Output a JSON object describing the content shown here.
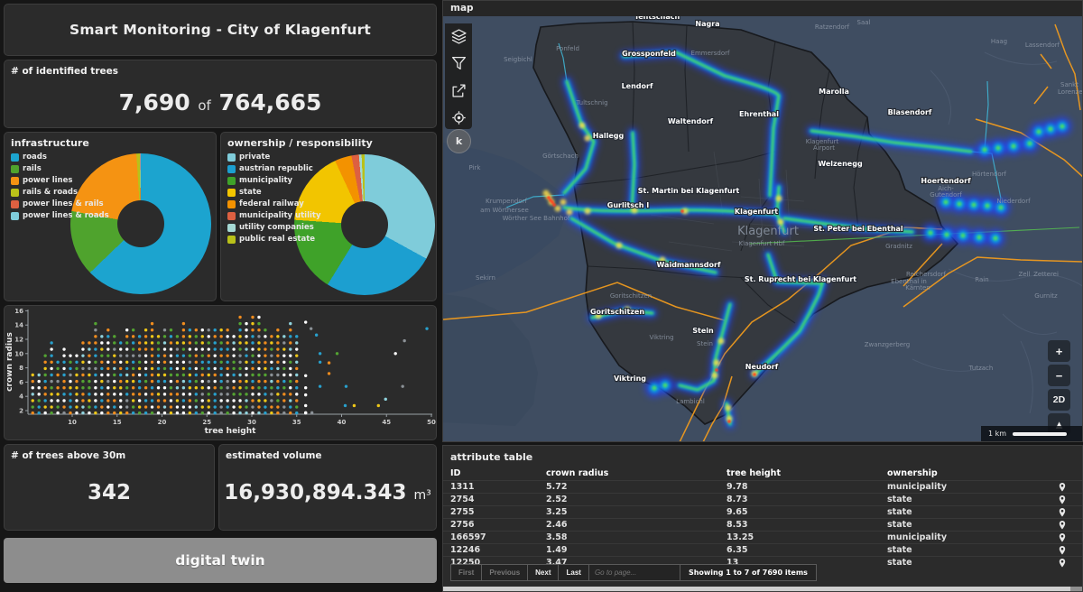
{
  "title": "Smart Monitoring - City of Klagenfurt",
  "identified_trees": {
    "label": "# of identified trees",
    "value": "7,690",
    "of_word": "of",
    "total": "764,665"
  },
  "chart_data": [
    {
      "type": "pie",
      "donut": true,
      "title": "infrastructure",
      "labels": [
        "roads",
        "rails",
        "power lines",
        "rails & roads",
        "power lines & rails",
        "power lines & roads"
      ],
      "values": [
        62.8,
        15.1,
        21.1,
        0.8,
        0.1,
        0.1
      ],
      "colors": [
        "#1ca4cf",
        "#4fa32d",
        "#f59312",
        "#b9c119",
        "#dd6041",
        "#7fccda"
      ],
      "legend_position": "left"
    },
    {
      "type": "pie",
      "donut": true,
      "title": "ownership / responsibility",
      "labels": [
        "private",
        "austrian republic",
        "municipality",
        "state",
        "federal railway",
        "municipality utility",
        "utility companies",
        "public real estate"
      ],
      "values": [
        33.0,
        25.8,
        17.3,
        17.0,
        3.9,
        1.7,
        0.6,
        0.7
      ],
      "colors": [
        "#7fccda",
        "#1c9fd0",
        "#3fa229",
        "#f2c500",
        "#f39200",
        "#dd6041",
        "#a5d9d4",
        "#b9c119"
      ],
      "legend_position": "left"
    },
    {
      "type": "scatter",
      "title": "",
      "xlabel": "tree height",
      "ylabel": "crown radius",
      "xlim": [
        5,
        50
      ],
      "ylim": [
        0,
        16
      ],
      "xticks": [
        10,
        15,
        20,
        25,
        30,
        35,
        40,
        45,
        50
      ],
      "yticks": [
        2,
        4,
        6,
        8,
        10,
        12,
        14,
        16
      ],
      "columns": {
        "x_start": 5.6,
        "x_step": 0.7,
        "y_start": 1.6,
        "y_step": 0.9,
        "y_max": [
          7.2,
          7.2,
          10,
          11.8,
          9,
          10.8,
          10,
          10,
          11.8,
          11.8,
          14.4,
          12.6,
          13.5,
          12.6,
          11.8,
          13.5,
          13.5,
          12.6,
          13.5,
          14.4,
          12.6,
          13.5,
          13.5,
          12.6,
          14.4,
          13.5,
          13.5,
          13.5,
          13.5,
          13.5,
          13.5,
          13.5,
          12.6,
          15.3,
          14.4,
          15.3,
          15.3,
          13.5,
          12.6,
          13.5,
          12.6,
          14.4,
          12.6
        ]
      },
      "outliers": [
        [
          36,
          14.4,
          1
        ],
        [
          36,
          6.9,
          1
        ],
        [
          36,
          5.2,
          1
        ],
        [
          36,
          4.2,
          1
        ],
        [
          36,
          2.7,
          1
        ],
        [
          36,
          1.7,
          1
        ],
        [
          36,
          0.9,
          1
        ],
        [
          36.6,
          13.5,
          5
        ],
        [
          36.7,
          1.7,
          5
        ],
        [
          37.2,
          12.6,
          2
        ],
        [
          37.6,
          10,
          2
        ],
        [
          37.6,
          8.8,
          2
        ],
        [
          37.6,
          5.4,
          2
        ],
        [
          38.6,
          8.7,
          0
        ],
        [
          38.6,
          7.2,
          0
        ],
        [
          39.5,
          10,
          3
        ],
        [
          40.4,
          2.7,
          2
        ],
        [
          40.5,
          5.4,
          2
        ],
        [
          41.4,
          2.7,
          4
        ],
        [
          44.1,
          2.7,
          4
        ],
        [
          44.9,
          3.6,
          6
        ],
        [
          46,
          10,
          1
        ],
        [
          46.8,
          5.4,
          5
        ],
        [
          47,
          11.8,
          5
        ],
        [
          49.5,
          13.5,
          2
        ]
      ],
      "point_colors": [
        "#f08c1e",
        "#ffffff",
        "#28a0cc",
        "#53a332",
        "#eec718",
        "#8b9196",
        "#8fd2dc"
      ]
    }
  ],
  "stats": {
    "above30": {
      "label": "# of trees above 30m",
      "value": "342"
    },
    "volume": {
      "label": "estimated volume",
      "value": "16,930,894.343",
      "unit": "m³"
    }
  },
  "digital_twin_label": "digital twin",
  "map": {
    "title": "map",
    "toolbar": [
      "layers",
      "filters",
      "share",
      "locate"
    ],
    "logo": "k",
    "controls": [
      "+",
      "−",
      "2D",
      "▲"
    ],
    "scale_label": "1 km",
    "labels_bold": [
      [
        "Tentschach",
        237,
        3
      ],
      [
        "Nagra",
        293,
        11
      ],
      [
        "Grossponfeld",
        228,
        44
      ],
      [
        "Lendorf",
        215,
        80
      ],
      [
        "Marolla",
        433,
        86
      ],
      [
        "Ehrenthal",
        350,
        111
      ],
      [
        "Blasendorf",
        517,
        109
      ],
      [
        "Waltendorf",
        274,
        119
      ],
      [
        "Hallegg",
        183,
        135
      ],
      [
        "Welzenegg",
        440,
        166
      ],
      [
        "Hoertendorf",
        557,
        185
      ],
      [
        "St. Martin bei Klagenfurt",
        272,
        196
      ],
      [
        "Gurlitsch I",
        205,
        212
      ],
      [
        "Klagenfurt",
        347,
        219
      ],
      [
        "St. Peter bei Ebenthal",
        460,
        238
      ],
      [
        "Waidmannsdorf",
        272,
        278
      ],
      [
        "St. Ruprecht bei Klagenfurt",
        396,
        294
      ],
      [
        "Goritschitzen",
        193,
        330
      ],
      [
        "Stein",
        288,
        351
      ],
      [
        "Neudorf",
        353,
        391
      ],
      [
        "Viktring",
        207,
        404
      ]
    ],
    "labels_faint": [
      [
        "Seigbichl",
        83,
        50
      ],
      [
        "Ponfeld",
        138,
        38
      ],
      [
        "Emmersdorf",
        296,
        43
      ],
      [
        "Ratzendorf",
        431,
        14
      ],
      [
        "Saal",
        466,
        9
      ],
      [
        "Haag",
        616,
        30
      ],
      [
        "Lassendorf",
        664,
        34
      ],
      [
        "Tultschnig",
        165,
        98
      ],
      [
        "Görtschach",
        130,
        157
      ],
      [
        "Pirk",
        35,
        170
      ],
      [
        "Krumpendorf",
        70,
        207
      ],
      [
        "am Wörthersee",
        68,
        217
      ],
      [
        "Wörther See Bahnhof",
        103,
        226
      ],
      [
        "Sekirn",
        47,
        292
      ],
      [
        "Goritschitzen",
        208,
        312
      ],
      [
        "Klagenfurt",
        360,
        242,
        13
      ],
      [
        "Klagenfurt Hbf",
        353,
        254
      ],
      [
        "Gradnitz",
        505,
        257
      ],
      [
        "Niederdorf",
        632,
        207
      ],
      [
        "Hörtendorf",
        605,
        177
      ],
      [
        "Aich-",
        557,
        193
      ],
      [
        "Gutendorf",
        557,
        200
      ],
      [
        "Reichersdorf",
        535,
        288
      ],
      [
        "Ebenthal in",
        516,
        296
      ],
      [
        "Kärnten",
        526,
        303
      ],
      [
        "Rain",
        597,
        294
      ],
      [
        "Zell",
        644,
        288
      ],
      [
        "Zetterei",
        668,
        288
      ],
      [
        "Gurnitz",
        668,
        312
      ],
      [
        "Zwanzgerberg",
        492,
        366
      ],
      [
        "Tutzach",
        596,
        392
      ],
      [
        "Lambichl",
        274,
        429
      ],
      [
        "Viktring",
        242,
        358
      ],
      [
        "Stein",
        290,
        365
      ],
      [
        "Klagenfurt",
        420,
        141
      ],
      [
        "Airport",
        422,
        148
      ],
      [
        "Sankt",
        694,
        78
      ],
      [
        "Lorenzen",
        697,
        86
      ]
    ]
  },
  "attribute_table": {
    "title": "attribute table",
    "columns": [
      "ID",
      "crown radius",
      "tree height",
      "ownership"
    ],
    "rows": [
      [
        "1311",
        "5.72",
        "9.78",
        "municipality"
      ],
      [
        "2754",
        "2.52",
        "8.73",
        "state"
      ],
      [
        "2755",
        "3.25",
        "9.65",
        "state"
      ],
      [
        "2756",
        "2.46",
        "8.53",
        "state"
      ],
      [
        "166597",
        "3.58",
        "13.25",
        "municipality"
      ],
      [
        "12246",
        "1.49",
        "6.35",
        "state"
      ],
      [
        "12250",
        "3.47",
        "13",
        "state"
      ]
    ],
    "pagination": {
      "first": "First",
      "previous": "Previous",
      "next": "Next",
      "last": "Last",
      "goto_placeholder": "Go to page...",
      "status": "Showing 1 to 7 of 7690 items"
    }
  }
}
